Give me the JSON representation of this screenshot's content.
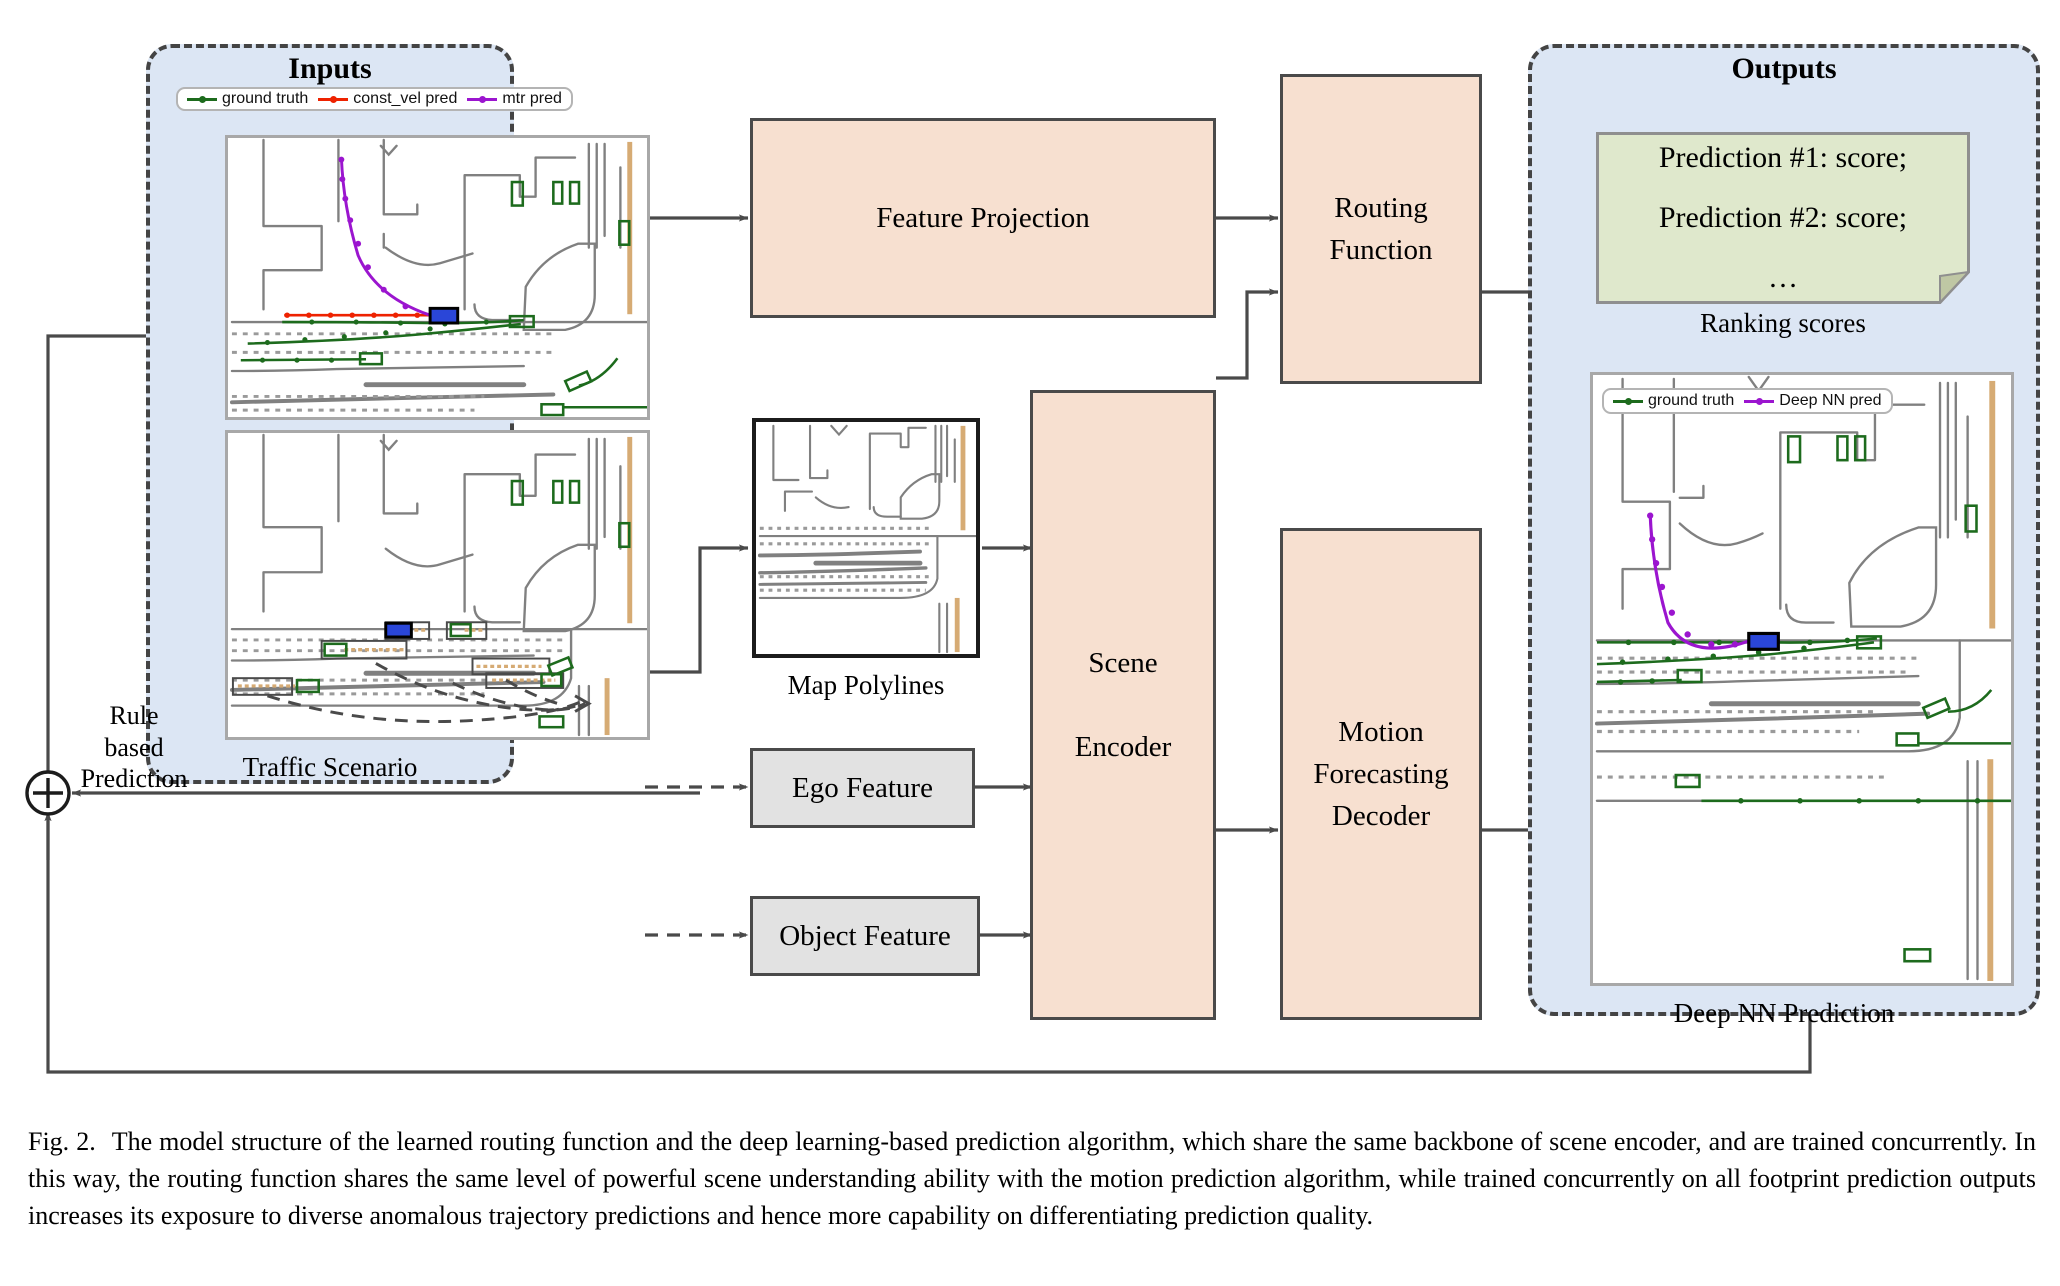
{
  "figure": {
    "label": "Fig. 2.",
    "caption": "The model structure of the learned routing function and the deep learning-based prediction algorithm, which share the same backbone of scene encoder, and are trained concurrently. In this way, the routing function shares the same level of powerful scene understanding ability with the motion prediction algorithm, while trained concurrently on all footprint prediction outputs increases its exposure to diverse anomalous trajectory predictions and hence more capability on differentiating prediction quality."
  },
  "inputs_panel": {
    "title": "Inputs",
    "caption": "Traffic Scenario",
    "legend": [
      {
        "label": "ground truth",
        "color": "#1d6b1d"
      },
      {
        "label": "const_vel pred",
        "color": "#ee2200"
      },
      {
        "label": "mtr pred",
        "color": "#9b15cf"
      }
    ]
  },
  "outputs_panel": {
    "title": "Outputs",
    "caption": "Deep NN Prediction",
    "note": {
      "lines": [
        "Prediction #1: score;",
        "Prediction #2: score;",
        "…"
      ],
      "caption": "Ranking scores",
      "fill": "#dfe8cc",
      "border": "#8f8f8f"
    },
    "legend": [
      {
        "label": "ground truth",
        "color": "#1d6b1d"
      },
      {
        "label": "Deep NN pred",
        "color": "#9b15cf"
      }
    ]
  },
  "blocks": {
    "feature_projection": "Feature Projection",
    "routing_function": "Routing\nFunction",
    "scene_encoder": "Scene\n\nEncoder",
    "motion_decoder": "Motion\nForecasting\nDecoder",
    "ego_feature": "Ego Feature",
    "object_feature": "Object Feature"
  },
  "labels": {
    "map_polylines": "Map Polylines",
    "rule_based_prediction": "Rule\nbased\nPrediction",
    "sum_node": "⊕"
  },
  "colors": {
    "panel_fill": "#dce6f4",
    "panel_border": "#444444",
    "process_fill": "#f7e0d0",
    "feature_fill": "#e2e2e2",
    "note_fill": "#dfe8cc",
    "stroke": "#4a4a4a",
    "map_line": "#808080",
    "ground_truth": "#1d6b1d",
    "const_vel": "#ee2200",
    "mtr_pred": "#9b15cf",
    "ego_vehicle": "#2a46d8",
    "curb": "#d6ab74"
  }
}
